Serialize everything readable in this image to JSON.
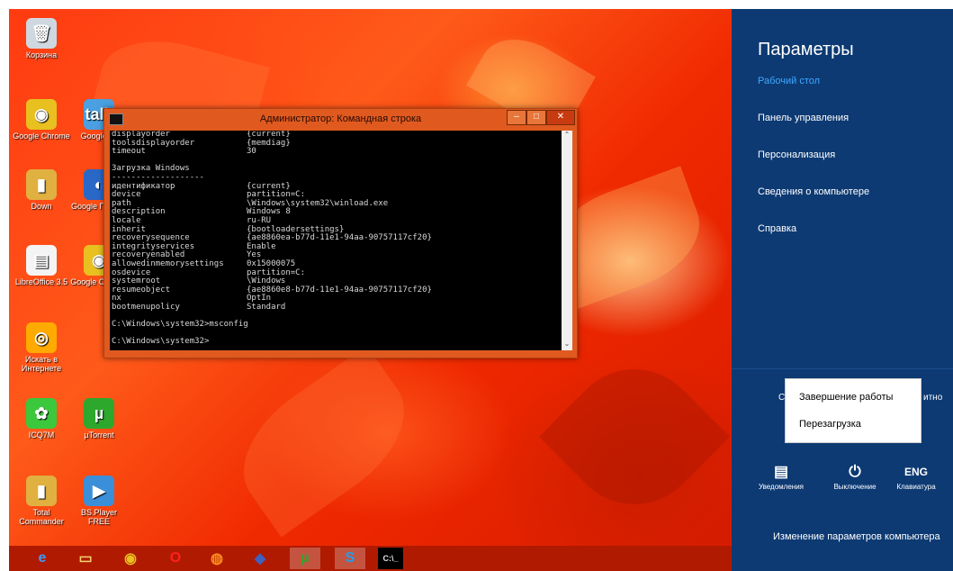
{
  "desktop": {
    "icons": [
      {
        "label": "Корзина",
        "glyph": "🗑",
        "color": "#cfd8e0"
      },
      {
        "label": "Google Chrome",
        "glyph": "◉",
        "color": "#e8c020"
      },
      {
        "label": "Google Ta",
        "glyph": "talk",
        "color": "#4aa0e0"
      },
      {
        "label": "Down",
        "glyph": "▮",
        "color": "#e0b040"
      },
      {
        "label": "Google Планет",
        "glyph": "◐",
        "color": "#2a68c8"
      },
      {
        "label": "LibreOffice 3.5",
        "glyph": "▤",
        "color": "#f4f4f4"
      },
      {
        "label": "Google Chrome",
        "glyph": "◉",
        "color": "#e8c020"
      },
      {
        "label": "Искать в Интернете",
        "glyph": "◎",
        "color": "#ffaa00"
      },
      {
        "label": "ICQ7M",
        "glyph": "✿",
        "color": "#3cc83c"
      },
      {
        "label": "µTorrent",
        "glyph": "µ",
        "color": "#2da82d"
      },
      {
        "label": "Total Commander",
        "glyph": "▮",
        "color": "#e0b040"
      },
      {
        "label": "BS.Player FREE",
        "glyph": "▶",
        "color": "#3b8fd8"
      }
    ]
  },
  "cmd_window": {
    "title": "Администратор: Командная строка",
    "controls": {
      "minimize": "–",
      "maximize": "□",
      "close": "✕"
    },
    "lines_top": [
      {
        "k": "displayorder",
        "v": "{current}"
      },
      {
        "k": "toolsdisplayorder",
        "v": "{memdiag}"
      },
      {
        "k": "timeout",
        "v": "30"
      }
    ],
    "section_title": "Загрузка Windows",
    "section_rule": "-------------------",
    "lines": [
      {
        "k": "идентификатор",
        "v": "{current}"
      },
      {
        "k": "device",
        "v": "partition=C:"
      },
      {
        "k": "path",
        "v": "\\Windows\\system32\\winload.exe"
      },
      {
        "k": "description",
        "v": "Windows 8"
      },
      {
        "k": "locale",
        "v": "ru-RU"
      },
      {
        "k": "inherit",
        "v": "{bootloadersettings}"
      },
      {
        "k": "recoverysequence",
        "v": "{ae8860ea-b77d-11e1-94aa-90757117cf20}"
      },
      {
        "k": "integrityservices",
        "v": "Enable"
      },
      {
        "k": "recoveryenabled",
        "v": "Yes"
      },
      {
        "k": "allowedinmemorysettings",
        "v": "0x15000075"
      },
      {
        "k": "osdevice",
        "v": "partition=C:"
      },
      {
        "k": "systemroot",
        "v": "\\Windows"
      },
      {
        "k": "resumeobject",
        "v": "{ae8860e8-b77d-11e1-94aa-90757117cf20}"
      },
      {
        "k": "nx",
        "v": "OptIn"
      },
      {
        "k": "bootmenupolicy",
        "v": "Standard"
      }
    ],
    "prompt1": "C:\\Windows\\system32>msconfig",
    "prompt2": "C:\\Windows\\system32>"
  },
  "taskbar": {
    "items": [
      {
        "name": "ie",
        "glyph": "e",
        "color": "#3a9bff"
      },
      {
        "name": "explorer",
        "glyph": "▭",
        "color": "#f4d070"
      },
      {
        "name": "chrome",
        "glyph": "◉",
        "color": "#e8c020"
      },
      {
        "name": "opera",
        "glyph": "O",
        "color": "#ff2020"
      },
      {
        "name": "firefox",
        "glyph": "◍",
        "color": "#ff9020"
      },
      {
        "name": "app",
        "glyph": "◆",
        "color": "#4060c0"
      },
      {
        "name": "utorrent",
        "glyph": "µ",
        "color": "#2da82d"
      },
      {
        "name": "skype",
        "glyph": "S",
        "color": "#1fa0f0"
      },
      {
        "name": "cmd",
        "glyph": "C:\\_",
        "color": "#e0e0e0"
      }
    ]
  },
  "charms": {
    "title": "Параметры",
    "subtitle": "Рабочий стол",
    "items": [
      "Панель управления",
      "Персонализация",
      "Сведения о компьютере",
      "Справка"
    ],
    "partial_left": "С",
    "partial_right": "итно",
    "buttons": [
      {
        "glyph": "▤",
        "label": "Уведомления"
      },
      {
        "glyph": "⏻",
        "label": "Выключение"
      },
      {
        "glyph": "ENG",
        "label": "Клавиатура"
      }
    ],
    "change_settings": "Изменение параметров компьютера",
    "power_menu": [
      "Завершение работы",
      "Перезагрузка"
    ]
  }
}
